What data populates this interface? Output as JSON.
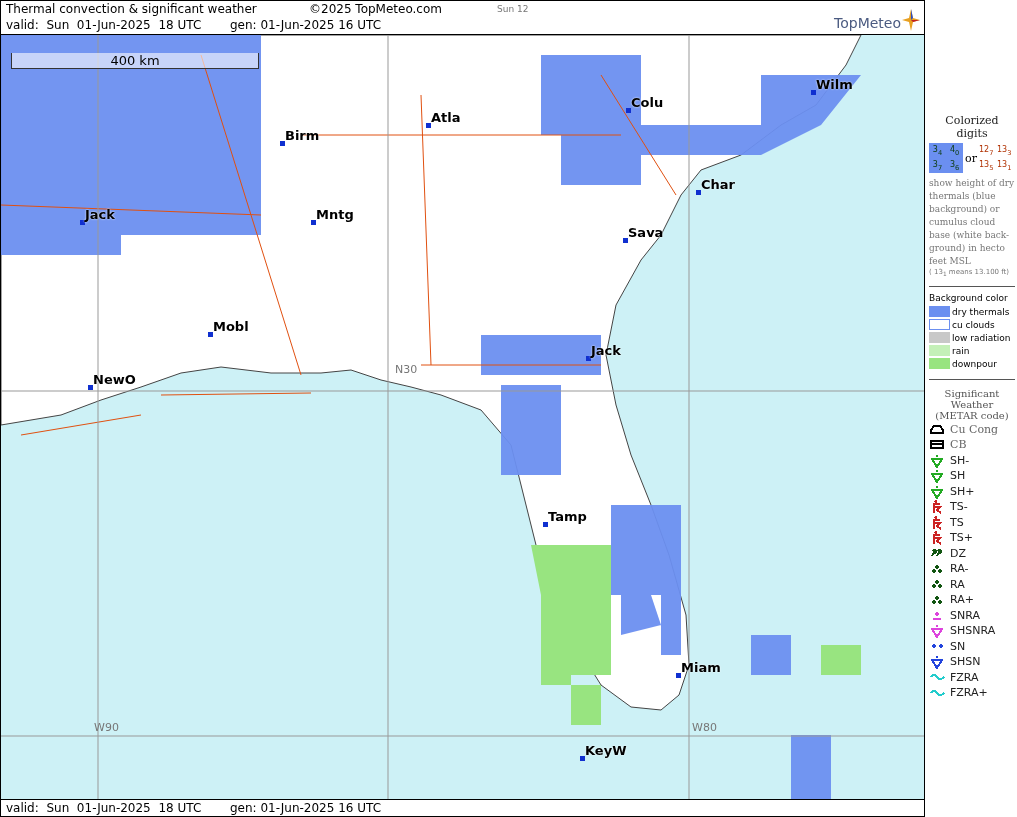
{
  "header": {
    "title": "Thermal convection & significant weather",
    "copyright": "©2025 TopMeteo.com",
    "day_label": "Sun 12",
    "valid": "valid:  Sun  01-Jun-2025  18 UTC",
    "generated": "gen: 01-Jun-2025 16 UTC",
    "logo": "TopMeteo"
  },
  "map": {
    "scale": "400 km",
    "grid_labels": [
      "W90",
      "W80",
      "N30"
    ],
    "cities": [
      "Wilm",
      "Colu",
      "Atla",
      "Birm",
      "Char",
      "Jack",
      "Sava",
      "Mntg",
      "Mobl",
      "NewO",
      "Jack",
      "Tamp",
      "Miam",
      "KeyW"
    ]
  },
  "footer": {
    "valid": "valid:  Sun  01-Jun-2025  18 UTC",
    "generated": "gen: 01-Jun-2025 16 UTC"
  },
  "legend": {
    "digits_title": "Colorized digits",
    "dry_samples": [
      "3$_{4}$",
      "4$_{0}$",
      "3$_{7}$",
      "3$_{6}$"
    ],
    "or": "or",
    "cloud_samples": [
      "12$_{7}$",
      "13$_{3}$",
      "13$_{5}$",
      "13$_{1}$"
    ],
    "description": "show height of dry thermals (blue background) or cumulus cloud base (white back-ground) in hecto feet MSL",
    "example": "( 13$_{1}$ means 13.100 ft)",
    "background_title": "Background color",
    "backgrounds": [
      {
        "label": "dry thermals",
        "color": "#6b8ff0"
      },
      {
        "label": "cu clouds",
        "color": "#ffffff"
      },
      {
        "label": "low radiation",
        "color": "#c8c8c8"
      },
      {
        "label": "rain",
        "color": "#c4f0b8"
      },
      {
        "label": "downpour",
        "color": "#98e480"
      }
    ],
    "weather_title": "Significant Weather (METAR code)",
    "weather": [
      {
        "label": "Cu Cong",
        "kind": "cucong",
        "color": "#000000"
      },
      {
        "label": "CB",
        "kind": "cb",
        "color": "#000000"
      },
      {
        "label": "SH-",
        "kind": "shower",
        "color": "#22aa22"
      },
      {
        "label": "SH",
        "kind": "shower",
        "color": "#22aa22"
      },
      {
        "label": "SH+",
        "kind": "shower",
        "color": "#22aa22"
      },
      {
        "label": "TS-",
        "kind": "thunder",
        "color": "#cc2222"
      },
      {
        "label": "TS",
        "kind": "thunder",
        "color": "#cc2222"
      },
      {
        "label": "TS+",
        "kind": "thunder",
        "color": "#cc2222"
      },
      {
        "label": "DZ",
        "kind": "drizzle",
        "color": "#115511"
      },
      {
        "label": "RA-",
        "kind": "rain",
        "color": "#115511"
      },
      {
        "label": "RA",
        "kind": "rain",
        "color": "#115511"
      },
      {
        "label": "RA+",
        "kind": "rain",
        "color": "#115511"
      },
      {
        "label": "SNRA",
        "kind": "snowrain",
        "color": "#dd44dd"
      },
      {
        "label": "SHSNRA",
        "kind": "shower",
        "color": "#dd44dd"
      },
      {
        "label": "SN",
        "kind": "snow",
        "color": "#2244dd"
      },
      {
        "label": "SHSN",
        "kind": "shower",
        "color": "#2244dd"
      },
      {
        "label": "FZRA",
        "kind": "fzra",
        "color": "#22cccc"
      },
      {
        "label": "FZRA+",
        "kind": "fzra",
        "color": "#22cccc"
      }
    ]
  }
}
